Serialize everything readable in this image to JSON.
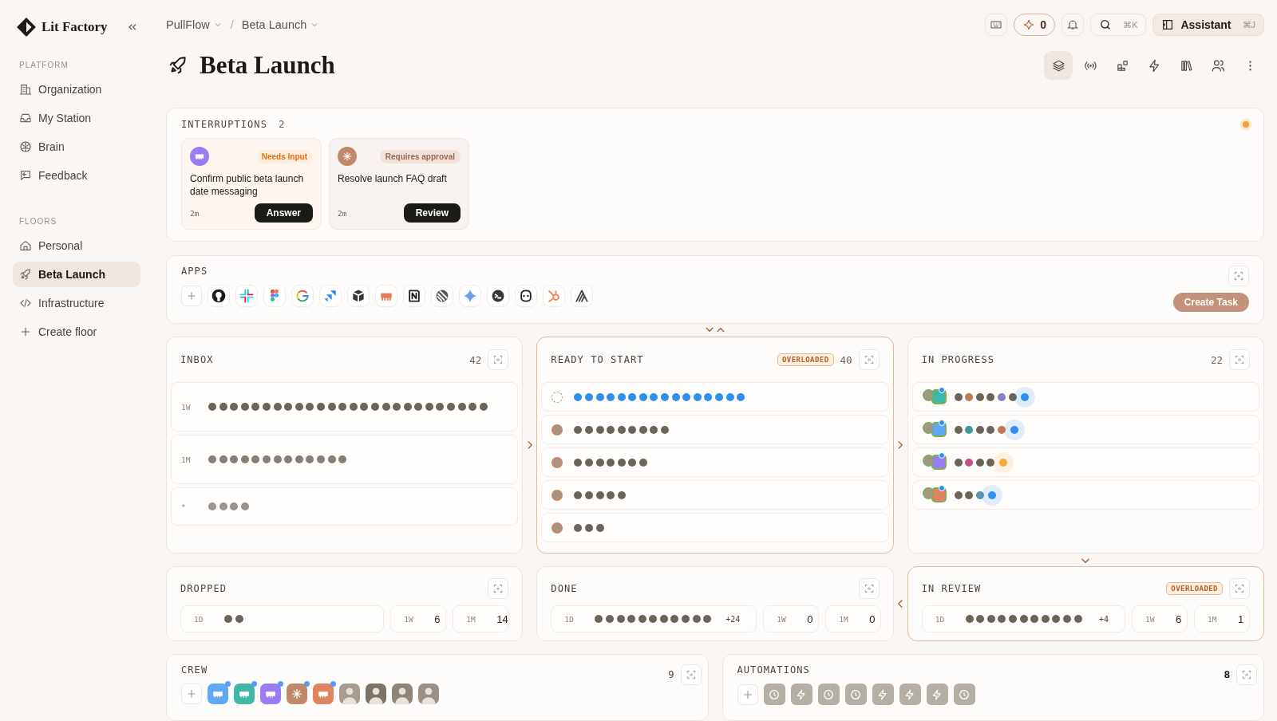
{
  "sidebar": {
    "brand": "Lit Factory",
    "sections": [
      {
        "title": "PLATFORM",
        "items": [
          {
            "label": "Organization",
            "selected": false
          },
          {
            "label": "My Station",
            "selected": false
          },
          {
            "label": "Brain",
            "selected": false
          },
          {
            "label": "Feedback",
            "selected": false
          }
        ]
      },
      {
        "title": "FLOORS",
        "items": [
          {
            "label": "Personal",
            "selected": false
          },
          {
            "label": "Beta Launch",
            "selected": true
          },
          {
            "label": "Infrastructure",
            "selected": false
          },
          {
            "label": "Create floor",
            "selected": false
          }
        ]
      }
    ]
  },
  "header": {
    "breadcrumbs": [
      {
        "label": "PullFlow"
      },
      {
        "label": "Beta Launch"
      }
    ],
    "separator": "/",
    "credits": "0",
    "search_shortcut": "⌘K",
    "assistant": {
      "label": "Assistant",
      "shortcut": "⌘J"
    }
  },
  "page": {
    "title": "Beta Launch"
  },
  "view_tabs": [
    {
      "selected": true
    },
    {
      "selected": false
    },
    {
      "selected": false
    },
    {
      "selected": false
    },
    {
      "selected": false
    },
    {
      "selected": false
    }
  ],
  "interruptions": {
    "title": "INTERRUPTIONS",
    "count": "2",
    "alert": true,
    "cards": [
      {
        "kind": "input",
        "avatar": {
          "kind": "bot",
          "color": "#9b7cf5"
        },
        "badge": "Needs Input",
        "text": "Confirm public beta launch date messaging",
        "age": "2m",
        "action": "Answer"
      },
      {
        "kind": "approval",
        "avatar": {
          "kind": "spark",
          "color": "#c0896a"
        },
        "badge": "Requires approval",
        "text": "Resolve launch FAQ draft",
        "age": "2m",
        "action": "Review"
      }
    ]
  },
  "apps": {
    "title": "APPS",
    "action": "Create Task"
  },
  "board": {
    "columns": [
      {
        "title": "INBOX",
        "count": "42",
        "overloaded": false,
        "rows": [
          {
            "label": "1W",
            "dots": [
              {
                "color": "#6b6459"
              },
              {
                "color": "#6b6459"
              },
              {
                "color": "#6b6459"
              },
              {
                "color": "#6b6459"
              },
              {
                "color": "#6b6459"
              },
              {
                "color": "#6b6459"
              },
              {
                "color": "#6b6459"
              },
              {
                "color": "#6b6459"
              },
              {
                "color": "#6b6459"
              },
              {
                "color": "#6b6459"
              },
              {
                "color": "#6b6459"
              },
              {
                "color": "#6b6459"
              },
              {
                "color": "#6b6459"
              },
              {
                "color": "#6b6459"
              },
              {
                "color": "#6b6459"
              },
              {
                "color": "#6b6459"
              },
              {
                "color": "#6b6459"
              },
              {
                "color": "#6b6459"
              },
              {
                "color": "#6b6459"
              },
              {
                "color": "#6b6459"
              },
              {
                "color": "#6b6459"
              },
              {
                "color": "#6b6459"
              },
              {
                "color": "#6b6459"
              },
              {
                "color": "#6b6459"
              },
              {
                "color": "#6b6459"
              },
              {
                "color": "#6b6459"
              }
            ]
          },
          {
            "label": "1M",
            "dots": [
              {
                "color": "#857e74"
              },
              {
                "color": "#857e74"
              },
              {
                "color": "#857e74"
              },
              {
                "color": "#857e74"
              },
              {
                "color": "#857e74"
              },
              {
                "color": "#857e74"
              },
              {
                "color": "#857e74"
              },
              {
                "color": "#857e74"
              },
              {
                "color": "#857e74"
              },
              {
                "color": "#857e74"
              },
              {
                "color": "#857e74"
              },
              {
                "color": "#857e74"
              },
              {
                "color": "#857e74"
              }
            ]
          },
          {
            "label": "*",
            "dots": [
              {
                "color": "#9b948b"
              },
              {
                "color": "#9b948b"
              },
              {
                "color": "#9b948b"
              },
              {
                "color": "#9b948b"
              }
            ]
          }
        ]
      },
      {
        "title": "READY TO START",
        "count": "40",
        "overloaded": true,
        "badge": "OVERLOADED",
        "rows": [
          {
            "assignee": {
              "kind": "unassigned"
            },
            "dots": [
              {
                "color": "#2f8ff0"
              },
              {
                "color": "#2f8ff0"
              },
              {
                "color": "#2f8ff0"
              },
              {
                "color": "#2f8ff0"
              },
              {
                "color": "#2f8ff0"
              },
              {
                "color": "#2f8ff0"
              },
              {
                "color": "#2f8ff0"
              },
              {
                "color": "#2f8ff0"
              },
              {
                "color": "#2f8ff0"
              },
              {
                "color": "#2f8ff0"
              },
              {
                "color": "#2f8ff0"
              },
              {
                "color": "#2f8ff0"
              },
              {
                "color": "#2f8ff0"
              },
              {
                "color": "#2f8ff0"
              },
              {
                "color": "#2f8ff0"
              },
              {
                "color": "#2f8ff0"
              }
            ]
          },
          {
            "assignee": {
              "kind": "person"
            },
            "dots": [
              {
                "color": "#6b6459"
              },
              {
                "color": "#6b6459"
              },
              {
                "color": "#6b6459"
              },
              {
                "color": "#6b6459"
              },
              {
                "color": "#6b6459"
              },
              {
                "color": "#6b6459"
              },
              {
                "color": "#6b6459"
              },
              {
                "color": "#6b6459"
              },
              {
                "color": "#6b6459"
              }
            ]
          },
          {
            "assignee": {
              "kind": "person"
            },
            "dots": [
              {
                "color": "#6b6459"
              },
              {
                "color": "#6b6459"
              },
              {
                "color": "#6b6459"
              },
              {
                "color": "#6b6459"
              },
              {
                "color": "#6b6459"
              },
              {
                "color": "#6b6459"
              },
              {
                "color": "#6b6459"
              }
            ]
          },
          {
            "assignee": {
              "kind": "person"
            },
            "dots": [
              {
                "color": "#6b6459"
              },
              {
                "color": "#6b6459"
              },
              {
                "color": "#6b6459"
              },
              {
                "color": "#6b6459"
              },
              {
                "color": "#6b6459"
              }
            ]
          },
          {
            "assignee": {
              "kind": "person"
            },
            "dots": [
              {
                "color": "#6b6459"
              },
              {
                "color": "#6b6459"
              },
              {
                "color": "#6b6459"
              }
            ]
          }
        ]
      },
      {
        "title": "IN PROGRESS",
        "count": "22",
        "overloaded": false,
        "rows": [
          {
            "assignee": {
              "kind": "pair",
              "color": "#3fb8a8"
            },
            "dots": [
              {
                "color": "#6b6459"
              },
              {
                "color": "#c07a55"
              },
              {
                "color": "#6b6459"
              },
              {
                "color": "#6b6459"
              },
              {
                "color": "#8a80c4"
              },
              {
                "color": "#6b6459"
              }
            ],
            "current": {
              "color": "#2f8ff0"
            }
          },
          {
            "assignee": {
              "kind": "pair",
              "color": "#5ea8f5"
            },
            "dots": [
              {
                "color": "#6b6459"
              },
              {
                "color": "#3b9aa0"
              },
              {
                "color": "#6b6459"
              },
              {
                "color": "#6b6459"
              },
              {
                "color": "#c07a55"
              }
            ],
            "current": {
              "color": "#2f8ff0"
            }
          },
          {
            "assignee": {
              "kind": "pair",
              "color": "#9b7cf5"
            },
            "dots": [
              {
                "color": "#6b6459"
              },
              {
                "color": "#c8508a"
              },
              {
                "color": "#6b6459"
              },
              {
                "color": "#6b6459"
              }
            ],
            "current": {
              "color": "#f5a93a"
            }
          },
          {
            "assignee": {
              "kind": "pair",
              "color": "#e0845f"
            },
            "dots": [
              {
                "color": "#6b6459"
              },
              {
                "color": "#6b6459"
              },
              {
                "color": "#5c8fb0"
              }
            ],
            "current": {
              "color": "#2f8ff0"
            }
          }
        ]
      }
    ]
  },
  "summaries": [
    {
      "title": "DROPPED",
      "overloaded": false,
      "periods": [
        {
          "kind": "dots",
          "label": "1D",
          "dots": [
            {
              "color": "#6b6459"
            },
            {
              "color": "#6b6459"
            }
          ]
        },
        {
          "kind": "value",
          "label": "1W",
          "value": "6"
        },
        {
          "kind": "value",
          "label": "1M",
          "value": "14"
        }
      ]
    },
    {
      "title": "DONE",
      "overloaded": false,
      "periods": [
        {
          "kind": "dots",
          "label": "1D",
          "more": "+24",
          "dots": [
            {
              "color": "#6b6459"
            },
            {
              "color": "#6b6459"
            },
            {
              "color": "#6b6459"
            },
            {
              "color": "#6b6459"
            },
            {
              "color": "#6b6459"
            },
            {
              "color": "#6b6459"
            },
            {
              "color": "#6b6459"
            },
            {
              "color": "#6b6459"
            },
            {
              "color": "#6b6459"
            },
            {
              "color": "#6b6459"
            },
            {
              "color": "#6b6459"
            }
          ]
        },
        {
          "kind": "value",
          "label": "1W",
          "value": "0"
        },
        {
          "kind": "value",
          "label": "1M",
          "value": "0"
        }
      ]
    },
    {
      "title": "IN REVIEW",
      "overloaded": true,
      "badge": "OVERLOADED",
      "periods": [
        {
          "kind": "dots",
          "label": "1D",
          "more": "+4",
          "dots": [
            {
              "color": "#6b6459"
            },
            {
              "color": "#6b6459"
            },
            {
              "color": "#6b6459"
            },
            {
              "color": "#6b6459"
            },
            {
              "color": "#6b6459"
            },
            {
              "color": "#6b6459"
            },
            {
              "color": "#6b6459"
            },
            {
              "color": "#6b6459"
            },
            {
              "color": "#6b6459"
            },
            {
              "color": "#6b6459"
            },
            {
              "color": "#6b6459"
            }
          ]
        },
        {
          "kind": "value",
          "label": "1W",
          "value": "6"
        },
        {
          "kind": "value",
          "label": "1M",
          "value": "1"
        }
      ]
    }
  ],
  "crew": {
    "title": "CREW",
    "count": "9",
    "members": [
      {
        "kind": "bot",
        "color": "#5ea8f5",
        "notified": true
      },
      {
        "kind": "bot",
        "color": "#3fb8a8",
        "notified": true
      },
      {
        "kind": "bot",
        "color": "#9b7cf5",
        "notified": true
      },
      {
        "kind": "spark",
        "color": "#c0896a",
        "notified": true
      },
      {
        "kind": "bot",
        "color": "#e0845f",
        "notified": true
      },
      {
        "kind": "person",
        "color": "#a89c90",
        "notified": false
      },
      {
        "kind": "person",
        "color": "#7d7468",
        "notified": false
      },
      {
        "kind": "person",
        "color": "#8f8478",
        "notified": false
      },
      {
        "kind": "person",
        "color": "#9a9088",
        "notified": false
      }
    ]
  },
  "automations": {
    "title": "AUTOMATIONS",
    "count": "8",
    "items": [
      {
        "kind": "clock"
      },
      {
        "kind": "bolt"
      },
      {
        "kind": "clock"
      },
      {
        "kind": "clock"
      },
      {
        "kind": "bolt"
      },
      {
        "kind": "bolt"
      },
      {
        "kind": "bolt"
      },
      {
        "kind": "clock"
      }
    ]
  }
}
